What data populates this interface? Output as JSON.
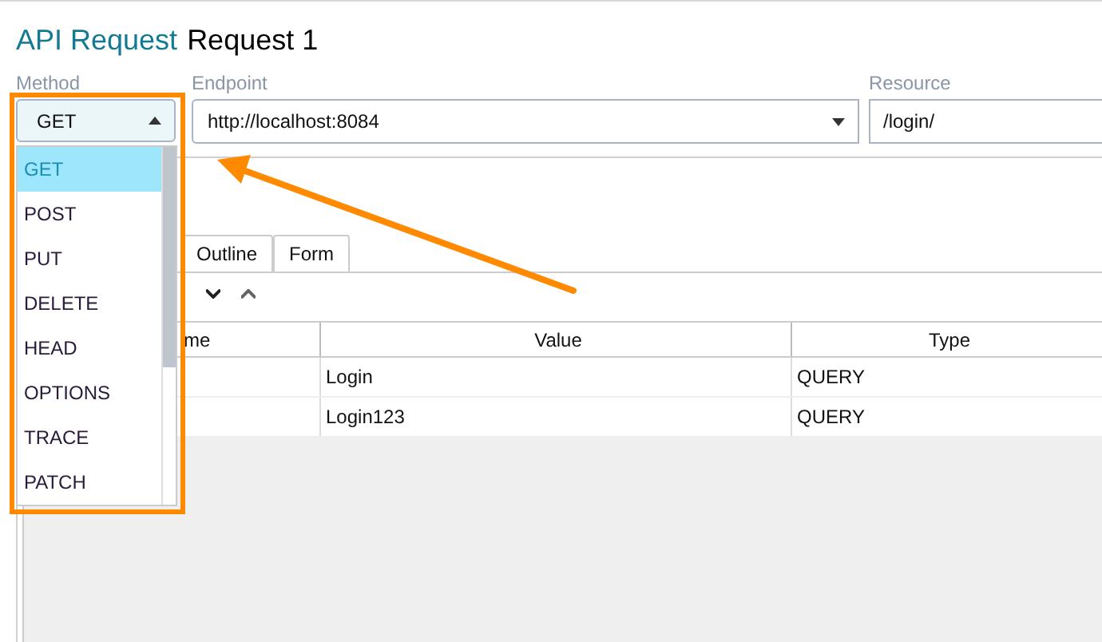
{
  "title": {
    "kind": "API Request",
    "name": "Request 1"
  },
  "fields": {
    "method": {
      "label": "Method",
      "value": "GET"
    },
    "endpoint": {
      "label": "Endpoint",
      "value": "http://localhost:8084"
    },
    "resource": {
      "label": "Resource",
      "value": "/login/"
    }
  },
  "method_menu": [
    {
      "label": "GET",
      "selected": true
    },
    {
      "label": "POST",
      "selected": false
    },
    {
      "label": "PUT",
      "selected": false
    },
    {
      "label": "DELETE",
      "selected": false
    },
    {
      "label": "HEAD",
      "selected": false
    },
    {
      "label": "OPTIONS",
      "selected": false
    },
    {
      "label": "TRACE",
      "selected": false
    },
    {
      "label": "PATCH",
      "selected": false
    }
  ],
  "tabs": [
    "Outline",
    "Form"
  ],
  "table": {
    "columns": [
      "me",
      "Value",
      "Type"
    ],
    "rows": [
      {
        "value": "Login",
        "type": "QUERY"
      },
      {
        "value": "Login123",
        "type": "QUERY"
      }
    ]
  }
}
